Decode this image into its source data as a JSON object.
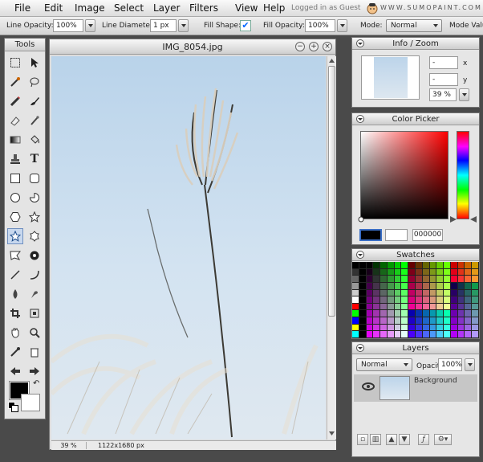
{
  "menubar": {
    "items": [
      "File",
      "Edit",
      "Image",
      "Select",
      "Layer",
      "Filters",
      "View",
      "Help"
    ],
    "logged_in": "Logged in as Guest",
    "brand": "WWW.SUMOPAINT.COM"
  },
  "options": {
    "line_opacity_label": "Line Opacity:",
    "line_opacity_value": "100%",
    "line_diameter_label": "Line Diameter:",
    "line_diameter_value": "1 px",
    "fill_shape_label": "Fill Shape:",
    "fill_shape_checked": "✔",
    "fill_opacity_label": "Fill Opacity:",
    "fill_opacity_value": "100%",
    "mode_label": "Mode:",
    "mode_value": "Normal",
    "mode_value_label": "Mode Valu"
  },
  "tools": {
    "title": "Tools",
    "swap_glyph": "↶"
  },
  "image_window": {
    "title": "IMG_8054.jpg",
    "zoom": "39 %",
    "size": "1122x1680 px"
  },
  "info_zoom": {
    "title": "Info / Zoom",
    "x_value": "-",
    "y_value": "-",
    "x_label": "x",
    "y_label": "y",
    "zoom_value": "39 %"
  },
  "color_picker": {
    "title": "Color Picker",
    "hex": "000000",
    "fg": "#000000",
    "bg": "#ffffff"
  },
  "swatches": {
    "title": "Swatches"
  },
  "layers": {
    "title": "Layers",
    "mode": "Normal",
    "opacity_label": "Opacity:",
    "opacity_value": "100%",
    "layer_name": "Background"
  }
}
